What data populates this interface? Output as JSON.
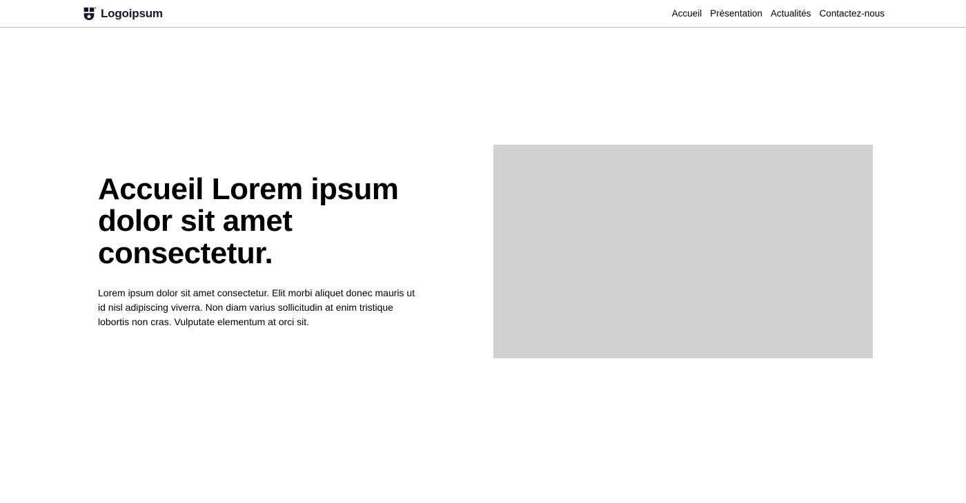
{
  "header": {
    "logo_text": "Logoipsum",
    "nav": [
      {
        "label": "Accueil"
      },
      {
        "label": "Présentation"
      },
      {
        "label": "Actualités"
      },
      {
        "label": "Contactez-nous"
      }
    ]
  },
  "hero": {
    "title": "Accueil Lorem ipsum dolor sit amet consectetur.",
    "body": "Lorem ipsum dolor sit amet consectetur. Elit morbi aliquet donec mauris ut id nisl adipiscing viverra. Non diam varius sollicitudin at enim tristique lobortis non cras. Vulputate elementum at orci sit."
  }
}
